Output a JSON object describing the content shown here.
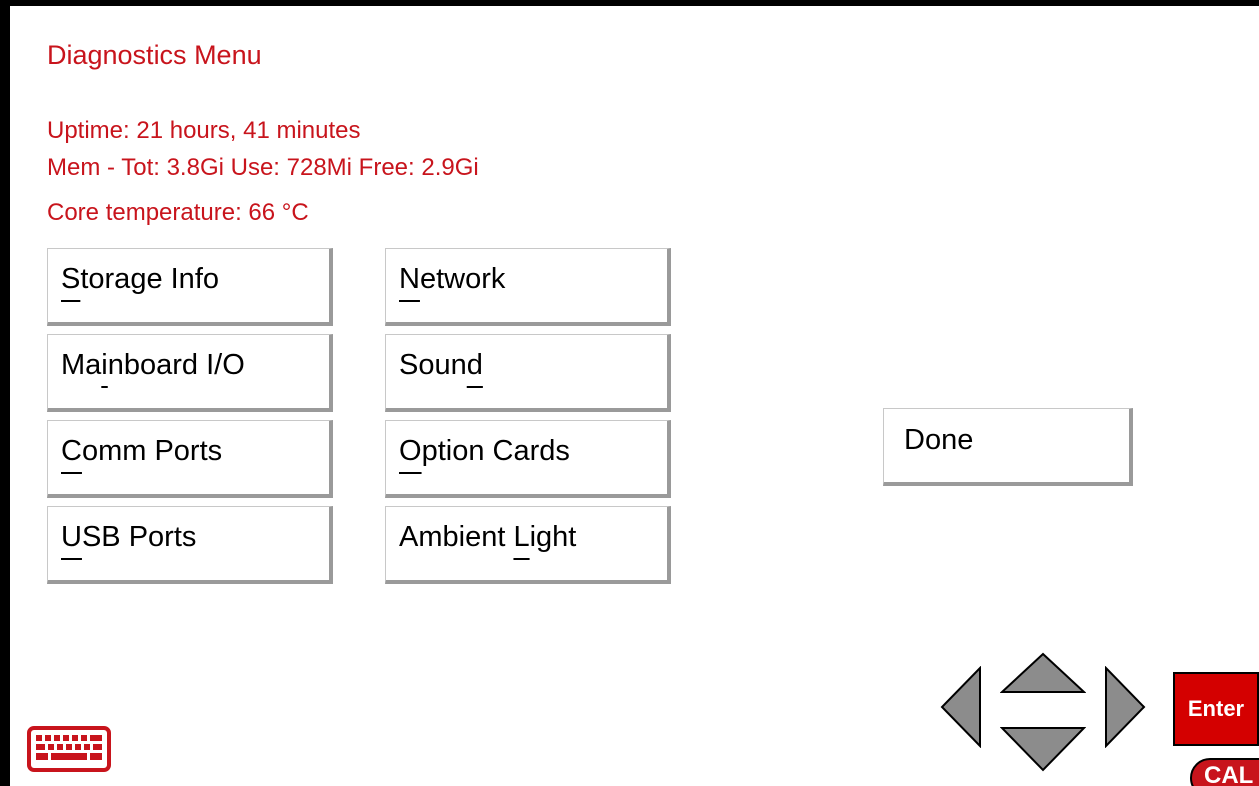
{
  "title": "Diagnostics Menu",
  "info": {
    "uptime": "Uptime: 21 hours, 41 minutes",
    "memory": "Mem - Tot: 3.8Gi Use: 728Mi Free: 2.9Gi",
    "temperature": "Core temperature: 66 °C"
  },
  "buttons": {
    "storage": {
      "pre": "",
      "hot": "S",
      "post": "torage Info"
    },
    "network": {
      "pre": "",
      "hot": "N",
      "post": "etwork"
    },
    "mainboard": {
      "pre": "Ma",
      "hot": "i",
      "post": "nboard I/O"
    },
    "sound": {
      "pre": "Soun",
      "hot": "d",
      "post": ""
    },
    "comm": {
      "pre": "",
      "hot": "C",
      "post": "omm Ports"
    },
    "option": {
      "pre": "",
      "hot": "O",
      "post": "ption Cards"
    },
    "usb": {
      "pre": "",
      "hot": "U",
      "post": "SB Ports"
    },
    "ambient": {
      "pre": "Ambient ",
      "hot": "L",
      "post": "ight"
    },
    "done": {
      "pre": "Done",
      "hot": "",
      "post": ""
    }
  },
  "nav": {
    "enter_label": "Enter",
    "cal_label": "CAL"
  },
  "colors": {
    "text_accent": "#c8141c",
    "enter_bg": "#d40000",
    "arrow_fill": "#8c8c8c"
  },
  "icons": [
    "keyboard-icon",
    "left-arrow-icon",
    "up-arrow-icon",
    "down-arrow-icon",
    "right-arrow-icon"
  ]
}
